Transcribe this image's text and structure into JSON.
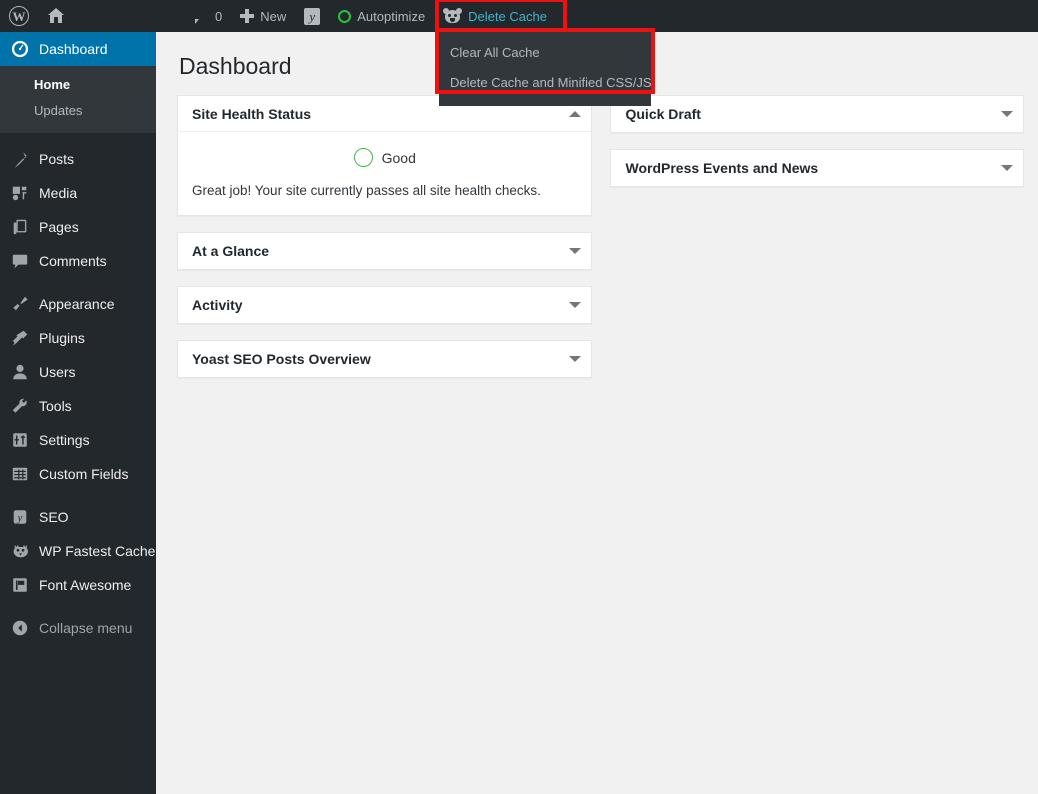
{
  "adminbar": {
    "wp_logo": "W",
    "home_label": "",
    "comments_count": "0",
    "new_label": "New",
    "yoast_label": "",
    "autoptimize_label": "Autoptimize",
    "delete_cache_label": "Delete Cache",
    "dropdown": {
      "items": [
        {
          "label": "Clear All Cache"
        },
        {
          "label": "Delete Cache and Minified CSS/JS"
        }
      ]
    }
  },
  "sidebar": {
    "items": [
      {
        "label": "Dashboard",
        "icon": "dashboard-icon",
        "current": true
      },
      {
        "label": "Posts",
        "icon": "pin-icon"
      },
      {
        "label": "Media",
        "icon": "media-icon"
      },
      {
        "label": "Pages",
        "icon": "pages-icon"
      },
      {
        "label": "Comments",
        "icon": "comment-icon"
      },
      {
        "label": "Appearance",
        "icon": "brush-icon"
      },
      {
        "label": "Plugins",
        "icon": "plug-icon"
      },
      {
        "label": "Users",
        "icon": "user-icon"
      },
      {
        "label": "Tools",
        "icon": "wrench-icon"
      },
      {
        "label": "Settings",
        "icon": "sliders-icon"
      },
      {
        "label": "Custom Fields",
        "icon": "table-icon"
      },
      {
        "label": "SEO",
        "icon": "yoast-icon"
      },
      {
        "label": "WP Fastest Cache",
        "icon": "cheetah-icon"
      },
      {
        "label": "Font Awesome",
        "icon": "flag-icon"
      },
      {
        "label": "Collapse menu",
        "icon": "collapse-icon"
      }
    ],
    "submenu": [
      {
        "label": "Home",
        "current": true
      },
      {
        "label": "Updates",
        "current": false
      }
    ]
  },
  "page": {
    "title": "Dashboard"
  },
  "widgets": {
    "site_health": {
      "title": "Site Health Status",
      "toggle": "up",
      "status_label": "Good",
      "description": "Great job! Your site currently passes all site health checks."
    },
    "collapsed_left": [
      {
        "title": "At a Glance",
        "toggle": "down"
      },
      {
        "title": "Activity",
        "toggle": "down"
      },
      {
        "title": "Yoast SEO Posts Overview",
        "toggle": "down"
      }
    ],
    "collapsed_right": [
      {
        "title": "Quick Draft",
        "toggle": "down"
      },
      {
        "title": "WordPress Events and News",
        "toggle": "down"
      }
    ]
  },
  "colors": {
    "admin_bar": "#23282d",
    "sidebar": "#23282d",
    "submenu": "#32373c",
    "current_menu": "#0073aa",
    "content_bg": "#f1f1f1",
    "highlight_red": "#ee1111",
    "delete_cache_text": "#4ab2c4",
    "health_green": "#46b450",
    "autoptimize_green": "#27c23c"
  }
}
